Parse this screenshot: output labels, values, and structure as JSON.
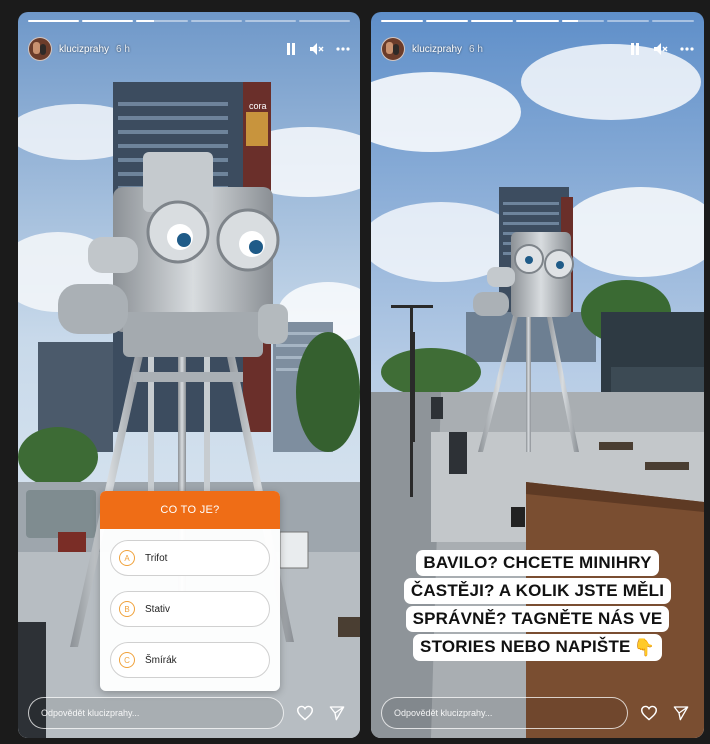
{
  "stories": [
    {
      "username": "klucizprahy",
      "time": "6 h",
      "reply_placeholder": "Odpovědět klucizprahy...",
      "building_sign": "cora",
      "progress": [
        1,
        1,
        0.35,
        0,
        0,
        0
      ],
      "quiz": {
        "title": "CO TO JE?",
        "options": [
          {
            "letter": "A",
            "text": "Trifot"
          },
          {
            "letter": "B",
            "text": "Stativ"
          },
          {
            "letter": "C",
            "text": "Šmírák"
          }
        ]
      }
    },
    {
      "username": "klucizprahy",
      "time": "6 h",
      "reply_placeholder": "Odpovědět klucizprahy...",
      "progress": [
        1,
        1,
        1,
        1,
        0.4,
        0,
        0
      ],
      "caption": [
        "BAVILO? CHCETE MINIHRY",
        "ČASTĚJI? A KOLIK JSTE MĚLI",
        "SPRÁVNĚ? TAGNĚTE NÁS VE",
        "STORIES NEBO NAPIŠTE"
      ],
      "caption_emoji": "👇"
    }
  ],
  "icons": {
    "pause": "pause-icon",
    "mute": "speaker-muted-icon",
    "more": "more-icon",
    "heart": "heart-icon",
    "send": "send-icon"
  },
  "colors": {
    "quiz_accent": "#ef6d16",
    "option_badge": "#f0a23c"
  }
}
